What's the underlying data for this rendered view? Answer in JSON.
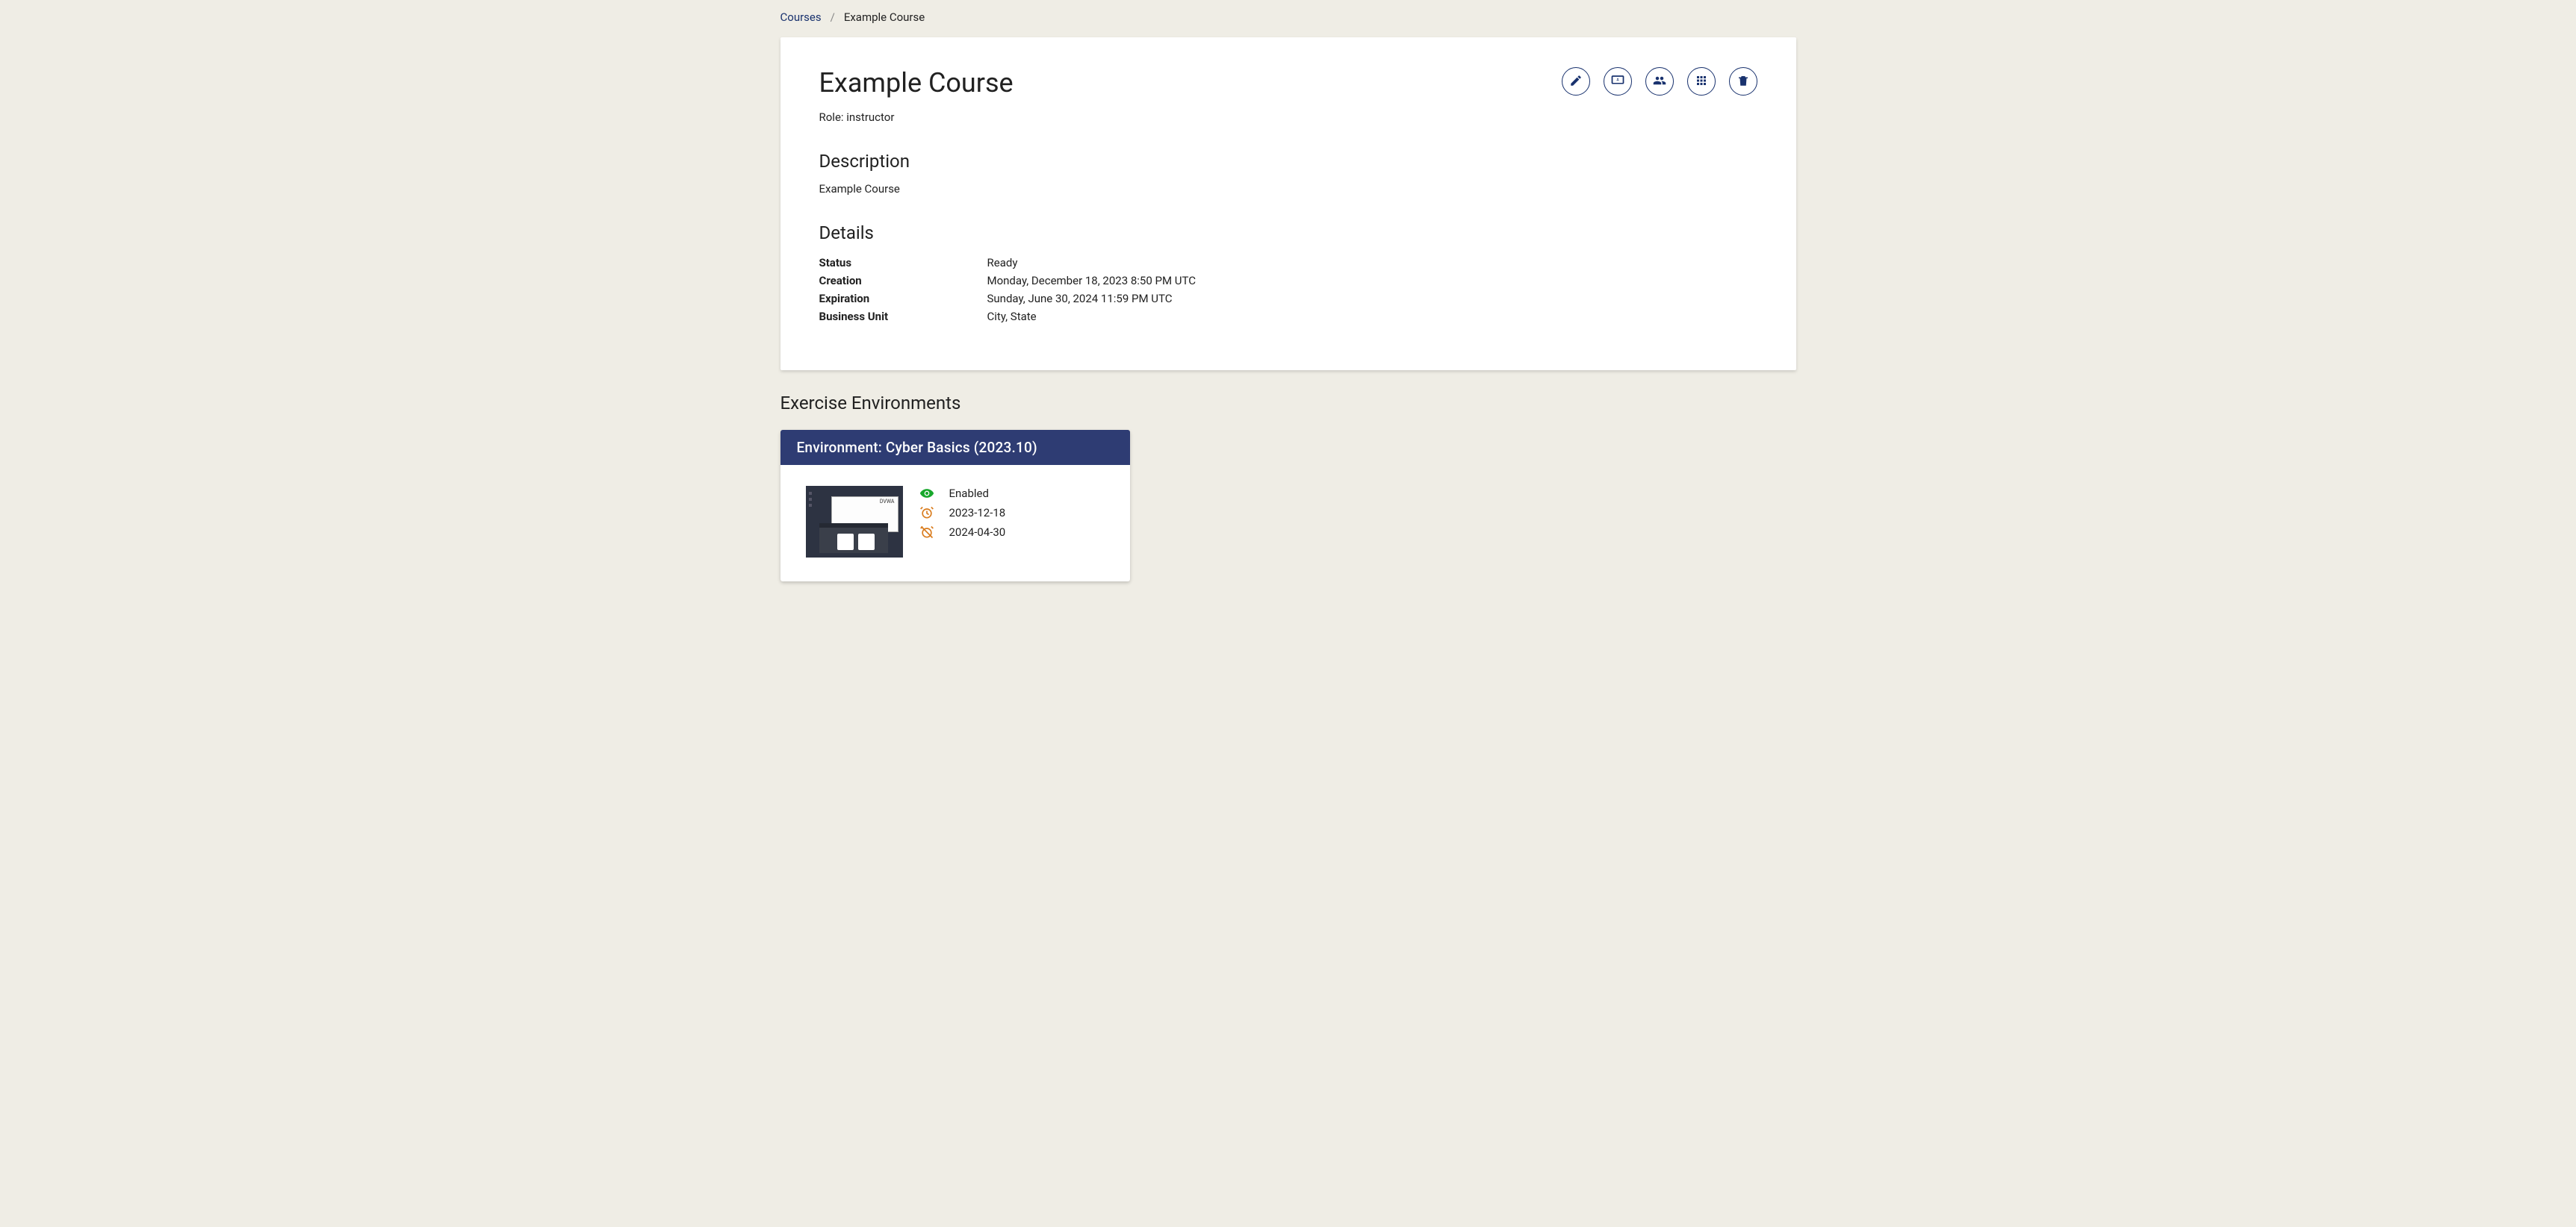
{
  "breadcrumb": {
    "parent": "Courses",
    "current": "Example Course"
  },
  "course": {
    "title": "Example Course",
    "role_label": "Role: instructor",
    "description_heading": "Description",
    "description_text": "Example Course",
    "details_heading": "Details",
    "details": [
      {
        "label": "Status",
        "value": "Ready"
      },
      {
        "label": "Creation",
        "value": "Monday, December 18, 2023 8:50 PM UTC"
      },
      {
        "label": "Expiration",
        "value": "Sunday, June 30, 2024 11:59 PM UTC"
      },
      {
        "label": "Business Unit",
        "value": "City, State"
      }
    ]
  },
  "actions": {
    "edit": "edit",
    "present": "present",
    "members": "members",
    "apps": "apps",
    "delete": "delete"
  },
  "environments": {
    "heading": "Exercise Environments",
    "items": [
      {
        "title": "Environment: Cyber Basics (2023.10)",
        "status": "Enabled",
        "start": "2023-12-18",
        "end": "2024-04-30"
      }
    ]
  }
}
